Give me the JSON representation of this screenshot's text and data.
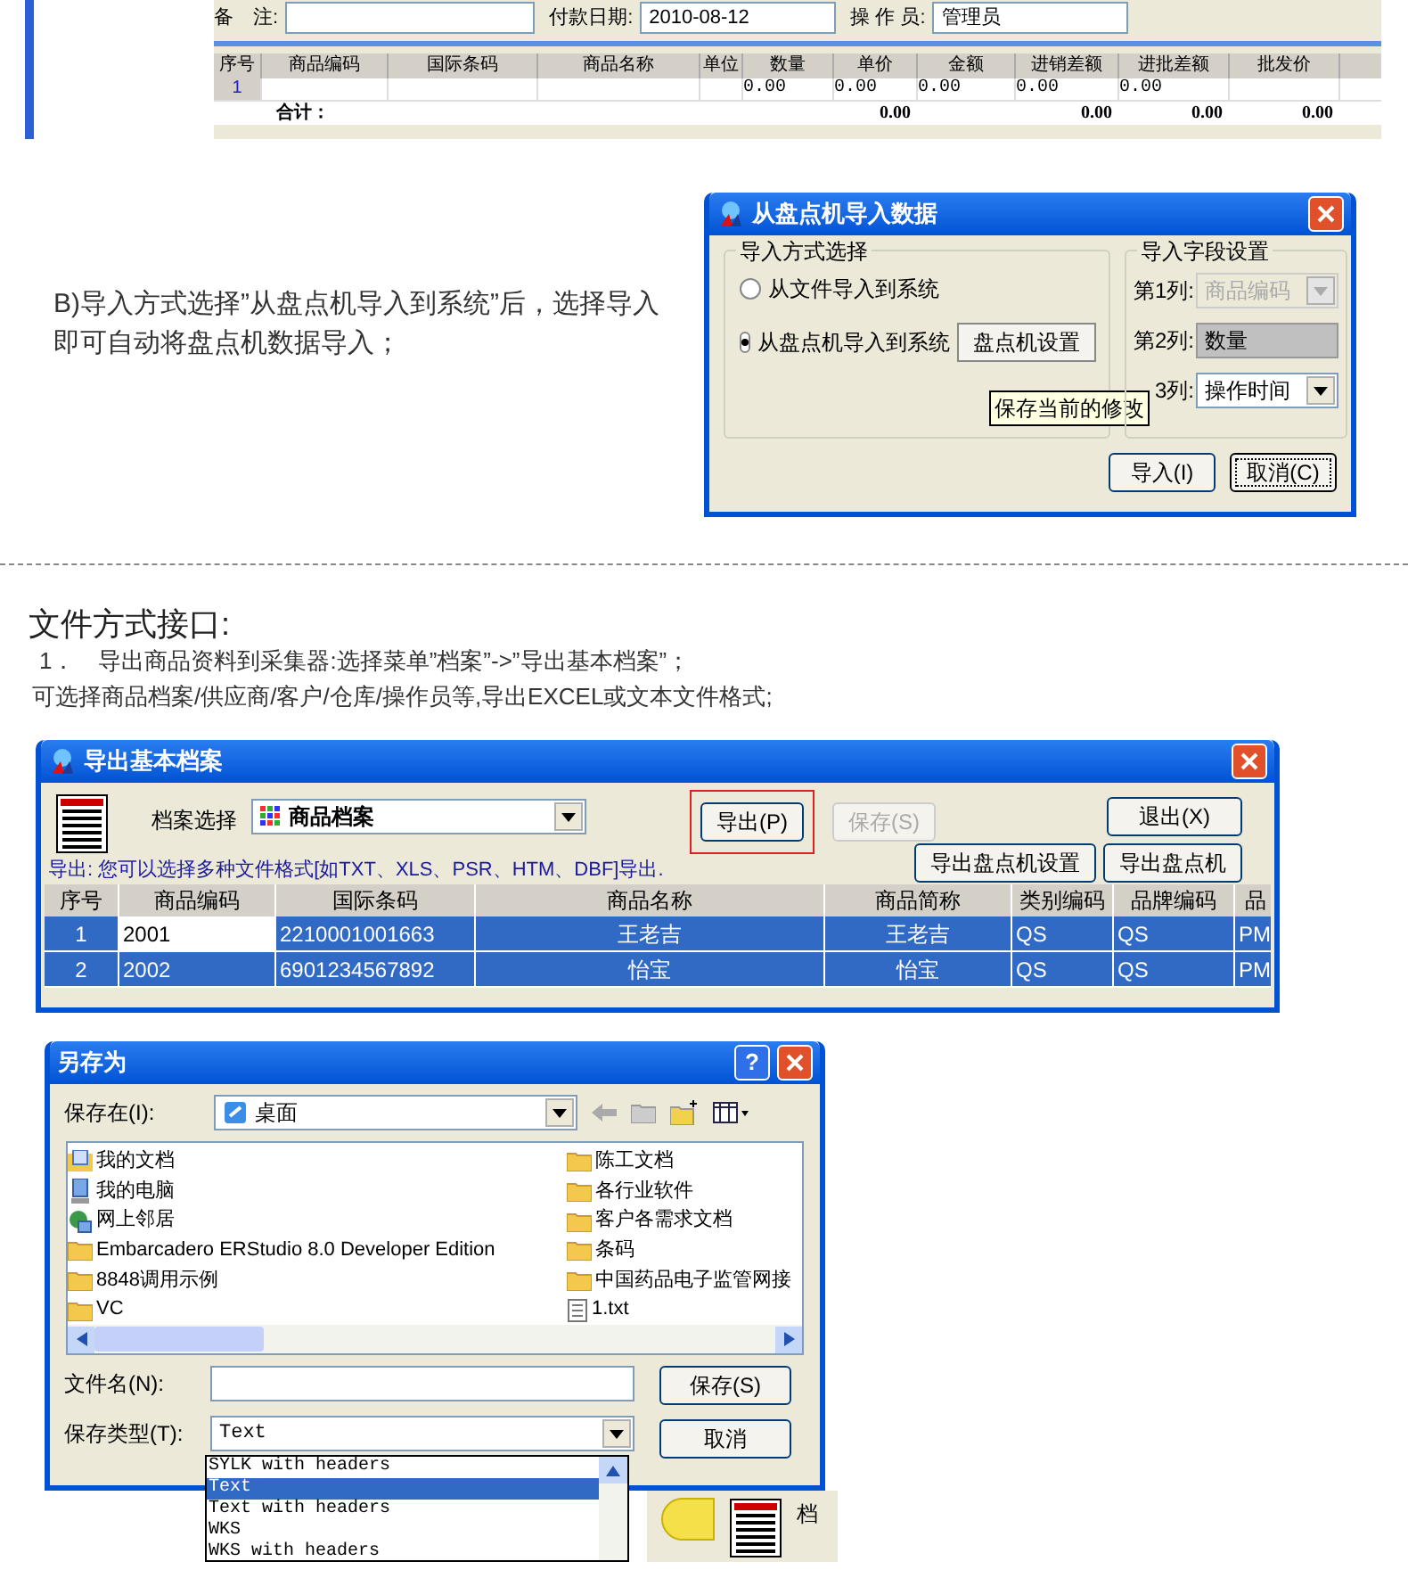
{
  "top_window": {
    "fields": [
      {
        "label": "备　注:"
      },
      {
        "label": "付款日期:",
        "value": "2010-08-12"
      },
      {
        "label": "操 作 员:",
        "value": "管理员"
      }
    ],
    "columns": [
      "序号",
      "商品编码",
      "国际条码",
      "商品名称",
      "单位",
      "数量",
      "单价",
      "金额",
      "进销差额",
      "进批差额",
      "批发价"
    ],
    "rows": [
      {
        "cells": [
          "1",
          "",
          "",
          "",
          "",
          "0.00",
          "0.00",
          "0.00",
          "0.00",
          "0.00",
          ""
        ]
      }
    ],
    "total": {
      "label": "合计：",
      "cells": [
        "",
        "",
        "",
        "",
        "0.00",
        "",
        "0.00",
        "0.00",
        "0.00",
        ""
      ]
    }
  },
  "note_b": "B)导入方式选择”从盘点机导入到系统”后，选择导入即可自动将盘点机数据导入；",
  "import_dialog": {
    "title": "从盘点机导入数据",
    "method_group": "导入方式选择",
    "methods": [
      {
        "label": "从文件导入到系统",
        "selected": false
      },
      {
        "label": "从盘点机导入到系统",
        "selected": true
      }
    ],
    "device_button": "盘点机设置",
    "tooltip": "保存当前的修改",
    "field_group": "导入字段设置",
    "fields": [
      {
        "label": "第1列:",
        "value": "商品编码",
        "kind": "dropdown",
        "disabled": true
      },
      {
        "label": "第2列:",
        "value": "数量",
        "kind": "text",
        "disabled": false
      },
      {
        "label": "3列:",
        "value": "操作时间",
        "kind": "dropdown",
        "disabled": false
      }
    ],
    "buttons": [
      {
        "label": "导入(I)",
        "focused": false
      },
      {
        "label": "取消(C)",
        "focused": true
      }
    ]
  },
  "section_title": "文件方式接口:",
  "section_lines": [
    "1．　导出商品资料到采集器:选择菜单”档案”->”导出基本档案”；",
    "可选择商品档案/供应商/客户/仓库/操作员等,导出EXCEL或文本文件格式;"
  ],
  "export_window": {
    "title": "导出基本档案",
    "archive_label": "档案选择",
    "archive_value": "商品档案",
    "buttons": [
      {
        "label": "导出(P)",
        "highlighted": true,
        "disabled": false
      },
      {
        "label": "保存(S)",
        "highlighted": false,
        "disabled": true
      }
    ],
    "exit_button": "退出(X)",
    "device_buttons": [
      "导出盘点机设置",
      "导出盘点机"
    ],
    "hint": "导出: 您可以选择多种文件格式[如TXT、XLS、PSR、HTM、DBF]导出.",
    "columns": [
      "序号",
      "商品编码",
      "国际条码",
      "商品名称",
      "商品简称",
      "类别编码",
      "品牌编码",
      "品"
    ],
    "rows": [
      {
        "selected": true,
        "cells": [
          "1",
          "2001",
          "2210001001663",
          "王老吉",
          "王老吉",
          "QS",
          "QS",
          "PM"
        ]
      },
      {
        "selected": true,
        "cells": [
          "2",
          "2002",
          "6901234567892",
          "怡宝",
          "怡宝",
          "QS",
          "QS",
          "PM"
        ]
      }
    ]
  },
  "save_dialog": {
    "title": "另存为",
    "help_label": "?",
    "location_label": "保存在(I):",
    "location": "桌面",
    "items": [
      {
        "name": "我的文档",
        "kind": "documents"
      },
      {
        "name": "我的电脑",
        "kind": "computer"
      },
      {
        "name": "网上邻居",
        "kind": "network"
      },
      {
        "name": "Embarcadero ERStudio 8.0 Developer Edition",
        "kind": "folder"
      },
      {
        "name": "8848调用示例",
        "kind": "folder"
      },
      {
        "name": "VC",
        "kind": "folder"
      },
      {
        "name": "陈工文档",
        "kind": "folder"
      },
      {
        "name": "各行业软件",
        "kind": "folder"
      },
      {
        "name": "客户各需求文档",
        "kind": "folder"
      },
      {
        "name": "条码",
        "kind": "folder"
      },
      {
        "name": "中国药品电子监管网接",
        "kind": "folder"
      },
      {
        "name": "1.txt",
        "kind": "file"
      }
    ],
    "filename_label": "文件名(N):",
    "type_label": "保存类型(T):",
    "type": "Text",
    "type_options": [
      {
        "label": "SYLK with headers",
        "selected": false
      },
      {
        "label": "Text",
        "selected": true
      },
      {
        "label": "Text with headers",
        "selected": false
      },
      {
        "label": "WKS",
        "selected": false
      },
      {
        "label": "WKS with headers",
        "selected": false
      }
    ],
    "buttons": [
      "保存(S)",
      "取消"
    ]
  },
  "behind_label": "档"
}
